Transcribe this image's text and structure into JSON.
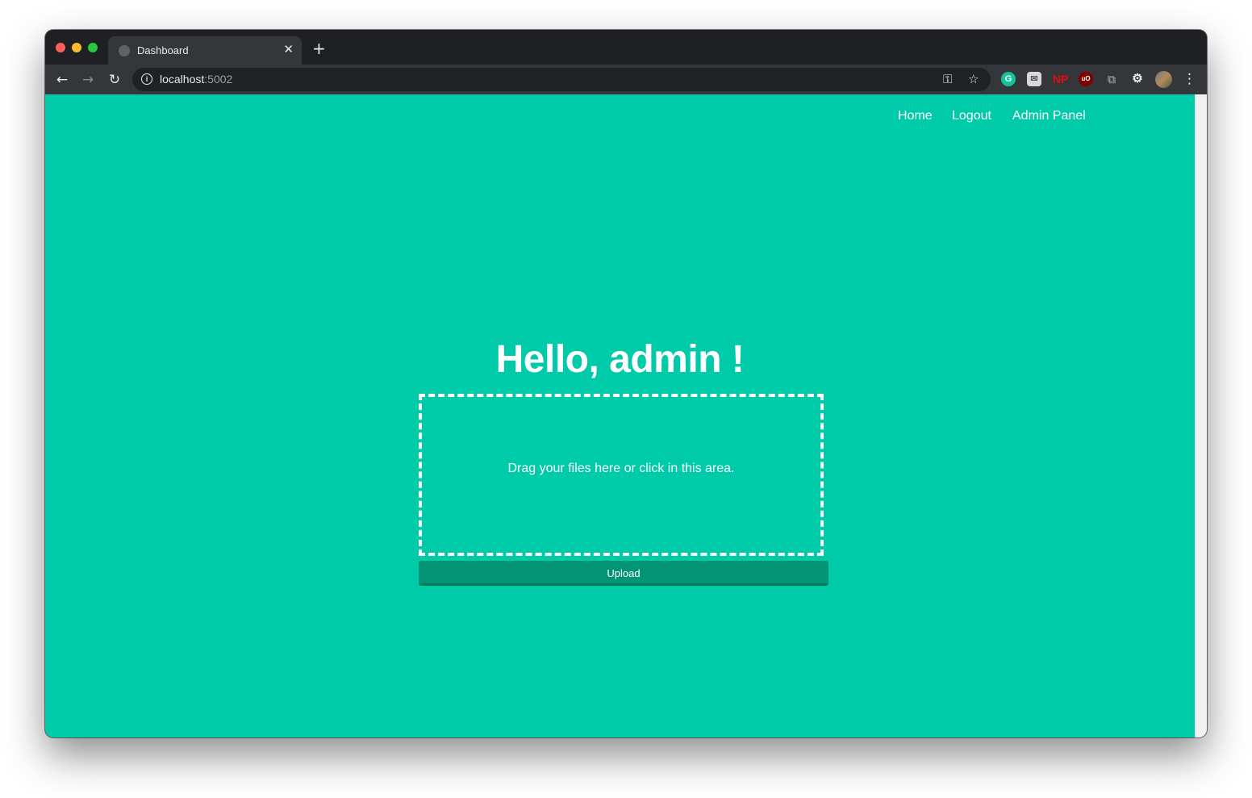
{
  "browser": {
    "tab_title": "Dashboard",
    "tab_close": "✕",
    "new_tab": "+",
    "url_host": "localhost",
    "url_port": ":5002",
    "extensions": {
      "grammarly": "G",
      "np": "NP",
      "ublock": "uO"
    }
  },
  "nav": {
    "home": "Home",
    "logout": "Logout",
    "admin_panel": "Admin Panel"
  },
  "main": {
    "greeting": "Hello, admin !",
    "dropzone_text": "Drag your files here or click in this area.",
    "upload_label": "Upload"
  },
  "colors": {
    "page_background": "#00cba9",
    "upload_button": "#029474",
    "browser_chrome": "#35363a"
  }
}
